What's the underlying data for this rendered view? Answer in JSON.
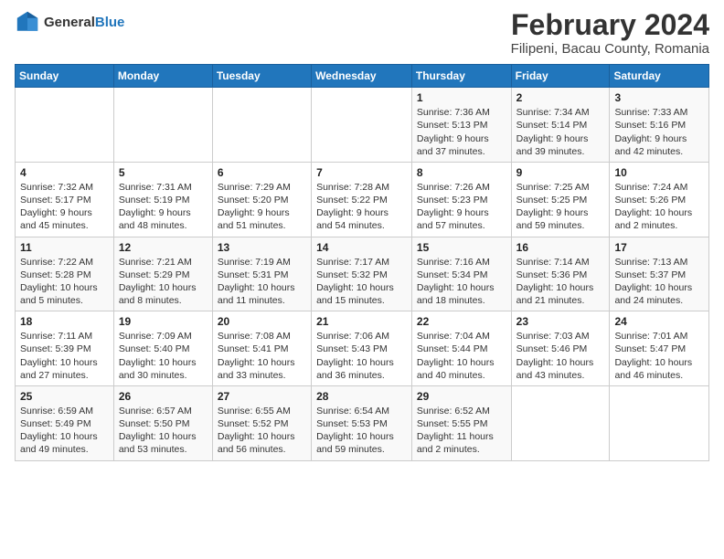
{
  "header": {
    "logo_general": "General",
    "logo_blue": "Blue",
    "month": "February 2024",
    "location": "Filipeni, Bacau County, Romania"
  },
  "weekdays": [
    "Sunday",
    "Monday",
    "Tuesday",
    "Wednesday",
    "Thursday",
    "Friday",
    "Saturday"
  ],
  "weeks": [
    [
      {
        "day": "",
        "info": ""
      },
      {
        "day": "",
        "info": ""
      },
      {
        "day": "",
        "info": ""
      },
      {
        "day": "",
        "info": ""
      },
      {
        "day": "1",
        "info": "Sunrise: 7:36 AM\nSunset: 5:13 PM\nDaylight: 9 hours\nand 37 minutes."
      },
      {
        "day": "2",
        "info": "Sunrise: 7:34 AM\nSunset: 5:14 PM\nDaylight: 9 hours\nand 39 minutes."
      },
      {
        "day": "3",
        "info": "Sunrise: 7:33 AM\nSunset: 5:16 PM\nDaylight: 9 hours\nand 42 minutes."
      }
    ],
    [
      {
        "day": "4",
        "info": "Sunrise: 7:32 AM\nSunset: 5:17 PM\nDaylight: 9 hours\nand 45 minutes."
      },
      {
        "day": "5",
        "info": "Sunrise: 7:31 AM\nSunset: 5:19 PM\nDaylight: 9 hours\nand 48 minutes."
      },
      {
        "day": "6",
        "info": "Sunrise: 7:29 AM\nSunset: 5:20 PM\nDaylight: 9 hours\nand 51 minutes."
      },
      {
        "day": "7",
        "info": "Sunrise: 7:28 AM\nSunset: 5:22 PM\nDaylight: 9 hours\nand 54 minutes."
      },
      {
        "day": "8",
        "info": "Sunrise: 7:26 AM\nSunset: 5:23 PM\nDaylight: 9 hours\nand 57 minutes."
      },
      {
        "day": "9",
        "info": "Sunrise: 7:25 AM\nSunset: 5:25 PM\nDaylight: 9 hours\nand 59 minutes."
      },
      {
        "day": "10",
        "info": "Sunrise: 7:24 AM\nSunset: 5:26 PM\nDaylight: 10 hours\nand 2 minutes."
      }
    ],
    [
      {
        "day": "11",
        "info": "Sunrise: 7:22 AM\nSunset: 5:28 PM\nDaylight: 10 hours\nand 5 minutes."
      },
      {
        "day": "12",
        "info": "Sunrise: 7:21 AM\nSunset: 5:29 PM\nDaylight: 10 hours\nand 8 minutes."
      },
      {
        "day": "13",
        "info": "Sunrise: 7:19 AM\nSunset: 5:31 PM\nDaylight: 10 hours\nand 11 minutes."
      },
      {
        "day": "14",
        "info": "Sunrise: 7:17 AM\nSunset: 5:32 PM\nDaylight: 10 hours\nand 15 minutes."
      },
      {
        "day": "15",
        "info": "Sunrise: 7:16 AM\nSunset: 5:34 PM\nDaylight: 10 hours\nand 18 minutes."
      },
      {
        "day": "16",
        "info": "Sunrise: 7:14 AM\nSunset: 5:36 PM\nDaylight: 10 hours\nand 21 minutes."
      },
      {
        "day": "17",
        "info": "Sunrise: 7:13 AM\nSunset: 5:37 PM\nDaylight: 10 hours\nand 24 minutes."
      }
    ],
    [
      {
        "day": "18",
        "info": "Sunrise: 7:11 AM\nSunset: 5:39 PM\nDaylight: 10 hours\nand 27 minutes."
      },
      {
        "day": "19",
        "info": "Sunrise: 7:09 AM\nSunset: 5:40 PM\nDaylight: 10 hours\nand 30 minutes."
      },
      {
        "day": "20",
        "info": "Sunrise: 7:08 AM\nSunset: 5:41 PM\nDaylight: 10 hours\nand 33 minutes."
      },
      {
        "day": "21",
        "info": "Sunrise: 7:06 AM\nSunset: 5:43 PM\nDaylight: 10 hours\nand 36 minutes."
      },
      {
        "day": "22",
        "info": "Sunrise: 7:04 AM\nSunset: 5:44 PM\nDaylight: 10 hours\nand 40 minutes."
      },
      {
        "day": "23",
        "info": "Sunrise: 7:03 AM\nSunset: 5:46 PM\nDaylight: 10 hours\nand 43 minutes."
      },
      {
        "day": "24",
        "info": "Sunrise: 7:01 AM\nSunset: 5:47 PM\nDaylight: 10 hours\nand 46 minutes."
      }
    ],
    [
      {
        "day": "25",
        "info": "Sunrise: 6:59 AM\nSunset: 5:49 PM\nDaylight: 10 hours\nand 49 minutes."
      },
      {
        "day": "26",
        "info": "Sunrise: 6:57 AM\nSunset: 5:50 PM\nDaylight: 10 hours\nand 53 minutes."
      },
      {
        "day": "27",
        "info": "Sunrise: 6:55 AM\nSunset: 5:52 PM\nDaylight: 10 hours\nand 56 minutes."
      },
      {
        "day": "28",
        "info": "Sunrise: 6:54 AM\nSunset: 5:53 PM\nDaylight: 10 hours\nand 59 minutes."
      },
      {
        "day": "29",
        "info": "Sunrise: 6:52 AM\nSunset: 5:55 PM\nDaylight: 11 hours\nand 2 minutes."
      },
      {
        "day": "",
        "info": ""
      },
      {
        "day": "",
        "info": ""
      }
    ]
  ]
}
